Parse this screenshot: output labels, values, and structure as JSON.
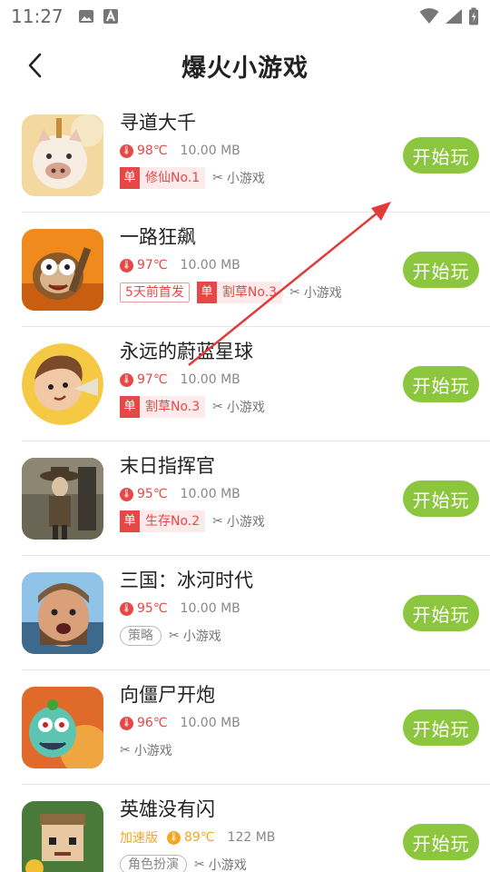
{
  "status_bar": {
    "time": "11:27"
  },
  "header": {
    "title": "爆火小游戏"
  },
  "colors": {
    "accent": "#8cc63f",
    "hot": "#e64848",
    "speed": "#f5a623"
  },
  "games": [
    {
      "name": "寻道大千",
      "temp": "98℃",
      "size": "10.00 MB",
      "rank_tag": "单",
      "rank": "修仙No.1",
      "category": "小游戏",
      "play": "开始玩"
    },
    {
      "name": "一路狂飙",
      "temp": "97℃",
      "size": "10.00 MB",
      "badge": "5天前首发",
      "rank_tag": "单",
      "rank": "割草No.3",
      "category": "小游戏",
      "play": "开始玩"
    },
    {
      "name": "永远的蔚蓝星球",
      "temp": "97℃",
      "size": "10.00 MB",
      "rank_tag": "单",
      "rank": "割草No.3",
      "category": "小游戏",
      "play": "开始玩"
    },
    {
      "name": "末日指挥官",
      "temp": "95℃",
      "size": "10.00 MB",
      "rank_tag": "单",
      "rank": "生存No.2",
      "category": "小游戏",
      "play": "开始玩"
    },
    {
      "name": "三国：冰河时代",
      "temp": "95℃",
      "size": "10.00 MB",
      "genre": "策略",
      "category": "小游戏",
      "play": "开始玩"
    },
    {
      "name": "向僵尸开炮",
      "temp": "96℃",
      "size": "10.00 MB",
      "category": "小游戏",
      "play": "开始玩"
    },
    {
      "name": "英雄没有闪",
      "speed_tag": "加速版",
      "temp": "89℃",
      "size": "122 MB",
      "genre": "角色扮演",
      "category": "小游戏",
      "play": "开始玩"
    }
  ]
}
